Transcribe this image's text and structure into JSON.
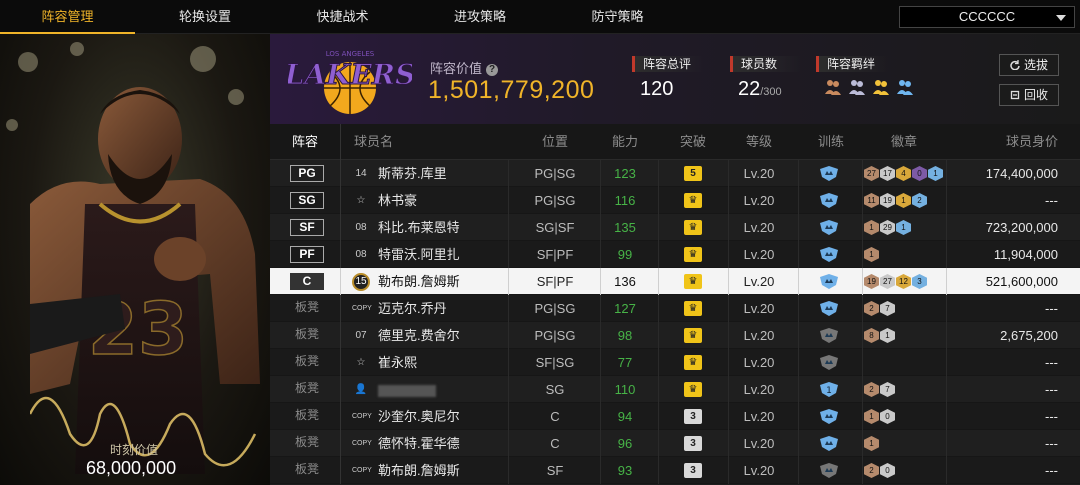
{
  "nav": {
    "tabs": [
      "阵容管理",
      "轮换设置",
      "快捷战术",
      "进攻策略",
      "防守策略"
    ],
    "active_tab": 0,
    "team_select_value": "CCCCCC"
  },
  "card": {
    "value_label": "时刻价值",
    "value": "68,000,000",
    "jersey_number": "23"
  },
  "header": {
    "team_logo_text": "LAKERS",
    "team_logo_sub": "LOS ANGELES",
    "lineup_value_label": "阵容价值",
    "lineup_value": "1,501,779,200",
    "rating_label": "阵容总评",
    "rating_value": "120",
    "players_label": "球员数",
    "players_value": "22",
    "players_max": "/300",
    "bonds_label": "阵容羁绊",
    "btn_select": "选拔",
    "btn_recycle": "回收"
  },
  "table": {
    "headers": {
      "pos": "阵容",
      "name": "球员名",
      "role": "位置",
      "ability": "能力",
      "break": "突破",
      "level": "等级",
      "train": "训练",
      "badges": "徽章",
      "price": "球员身价"
    },
    "rows": [
      {
        "slot": "PG",
        "bench": false,
        "jersey": "14",
        "name": "斯蒂芬.库里",
        "role": "PG|SG",
        "ability": "123",
        "green": true,
        "break_type": "gold",
        "break_text": "5",
        "level": "Lv.20",
        "train": "blue",
        "badges": [
          [
            "bronze",
            "27"
          ],
          [
            "silver",
            "17"
          ],
          [
            "gold",
            "4"
          ],
          [
            "purple",
            "0"
          ],
          [
            "blue",
            "1"
          ]
        ],
        "price": "174,400,000"
      },
      {
        "slot": "SG",
        "bench": false,
        "jersey": "☆",
        "name": "林书豪",
        "role": "PG|SG",
        "ability": "116",
        "green": true,
        "break_type": "gold",
        "break_text": "♛",
        "level": "Lv.20",
        "train": "blue",
        "badges": [
          [
            "bronze",
            "11"
          ],
          [
            "silver",
            "19"
          ],
          [
            "gold",
            "1"
          ],
          [
            "blue",
            "2"
          ]
        ],
        "price": "---"
      },
      {
        "slot": "SF",
        "bench": false,
        "jersey": "08",
        "name": "科比.布莱恩特",
        "role": "SG|SF",
        "ability": "135",
        "green": true,
        "break_type": "gold",
        "break_text": "♛",
        "level": "Lv.20",
        "train": "blue",
        "badges": [
          [
            "bronze",
            "1"
          ],
          [
            "silver",
            "29"
          ],
          [
            "blue",
            "1"
          ]
        ],
        "price": "723,200,000"
      },
      {
        "slot": "PF",
        "bench": false,
        "jersey": "08",
        "name": "特雷沃.阿里扎",
        "role": "SF|PF",
        "ability": "99",
        "green": true,
        "break_type": "gold",
        "break_text": "♛",
        "level": "Lv.20",
        "train": "blue",
        "badges": [
          [
            "bronze",
            "1"
          ]
        ],
        "price": "11,904,000"
      },
      {
        "slot": "C",
        "bench": false,
        "selected": true,
        "jersey": "15",
        "name": "勒布朗.詹姆斯",
        "role": "SF|PF",
        "ability": "136",
        "green": false,
        "break_type": "gold",
        "break_text": "♛",
        "level": "Lv.20",
        "train": "blue",
        "badges": [
          [
            "bronze",
            "19"
          ],
          [
            "silver",
            "27"
          ],
          [
            "gold",
            "12"
          ],
          [
            "blue",
            "3"
          ]
        ],
        "price": "521,600,000"
      },
      {
        "slot": "板凳",
        "bench": true,
        "jersey": "COPY",
        "name": "迈克尔.乔丹",
        "role": "PG|SG",
        "ability": "127",
        "green": true,
        "break_type": "gold",
        "break_text": "♛",
        "level": "Lv.20",
        "train": "blue",
        "badges": [
          [
            "bronze",
            "2"
          ],
          [
            "silver",
            "7"
          ]
        ],
        "price": "---"
      },
      {
        "slot": "板凳",
        "bench": true,
        "jersey": "07",
        "name": "德里克.费舍尔",
        "role": "PG|SG",
        "ability": "98",
        "green": true,
        "break_type": "gold",
        "break_text": "♛",
        "level": "Lv.20",
        "train": "gray",
        "badges": [
          [
            "bronze",
            "8"
          ],
          [
            "silver",
            "1"
          ]
        ],
        "price": "2,675,200"
      },
      {
        "slot": "板凳",
        "bench": true,
        "jersey": "☆",
        "name": "崔永熙",
        "role": "SF|SG",
        "ability": "77",
        "green": true,
        "break_type": "gold",
        "break_text": "♛",
        "level": "Lv.20",
        "train": "gray",
        "badges": [],
        "price": "---"
      },
      {
        "slot": "板凳",
        "bench": true,
        "jersey": "👤",
        "name": "",
        "blurred": true,
        "role": "SG",
        "ability": "110",
        "green": true,
        "break_type": "gold",
        "break_text": "♛",
        "level": "Lv.20",
        "train": "blue1",
        "badges": [
          [
            "bronze",
            "2"
          ],
          [
            "silver",
            "7"
          ]
        ],
        "price": "---"
      },
      {
        "slot": "板凳",
        "bench": true,
        "jersey": "COPY",
        "name": "沙奎尔.奥尼尔",
        "role": "C",
        "ability": "94",
        "green": true,
        "break_type": "gray",
        "break_text": "3",
        "level": "Lv.20",
        "train": "blue",
        "badges": [
          [
            "bronze",
            "1"
          ],
          [
            "silver",
            "0"
          ]
        ],
        "price": "---"
      },
      {
        "slot": "板凳",
        "bench": true,
        "jersey": "COPY",
        "name": "德怀特.霍华德",
        "role": "C",
        "ability": "96",
        "green": true,
        "break_type": "gray",
        "break_text": "3",
        "level": "Lv.20",
        "train": "blue",
        "badges": [
          [
            "bronze",
            "1"
          ]
        ],
        "price": "---"
      },
      {
        "slot": "板凳",
        "bench": true,
        "jersey": "COPY",
        "name": "勒布朗.詹姆斯",
        "role": "SF",
        "ability": "93",
        "green": true,
        "break_type": "gray",
        "break_text": "3",
        "level": "Lv.20",
        "train": "gray",
        "badges": [
          [
            "bronze",
            "2"
          ],
          [
            "silver",
            "0"
          ]
        ],
        "price": "---"
      }
    ]
  }
}
